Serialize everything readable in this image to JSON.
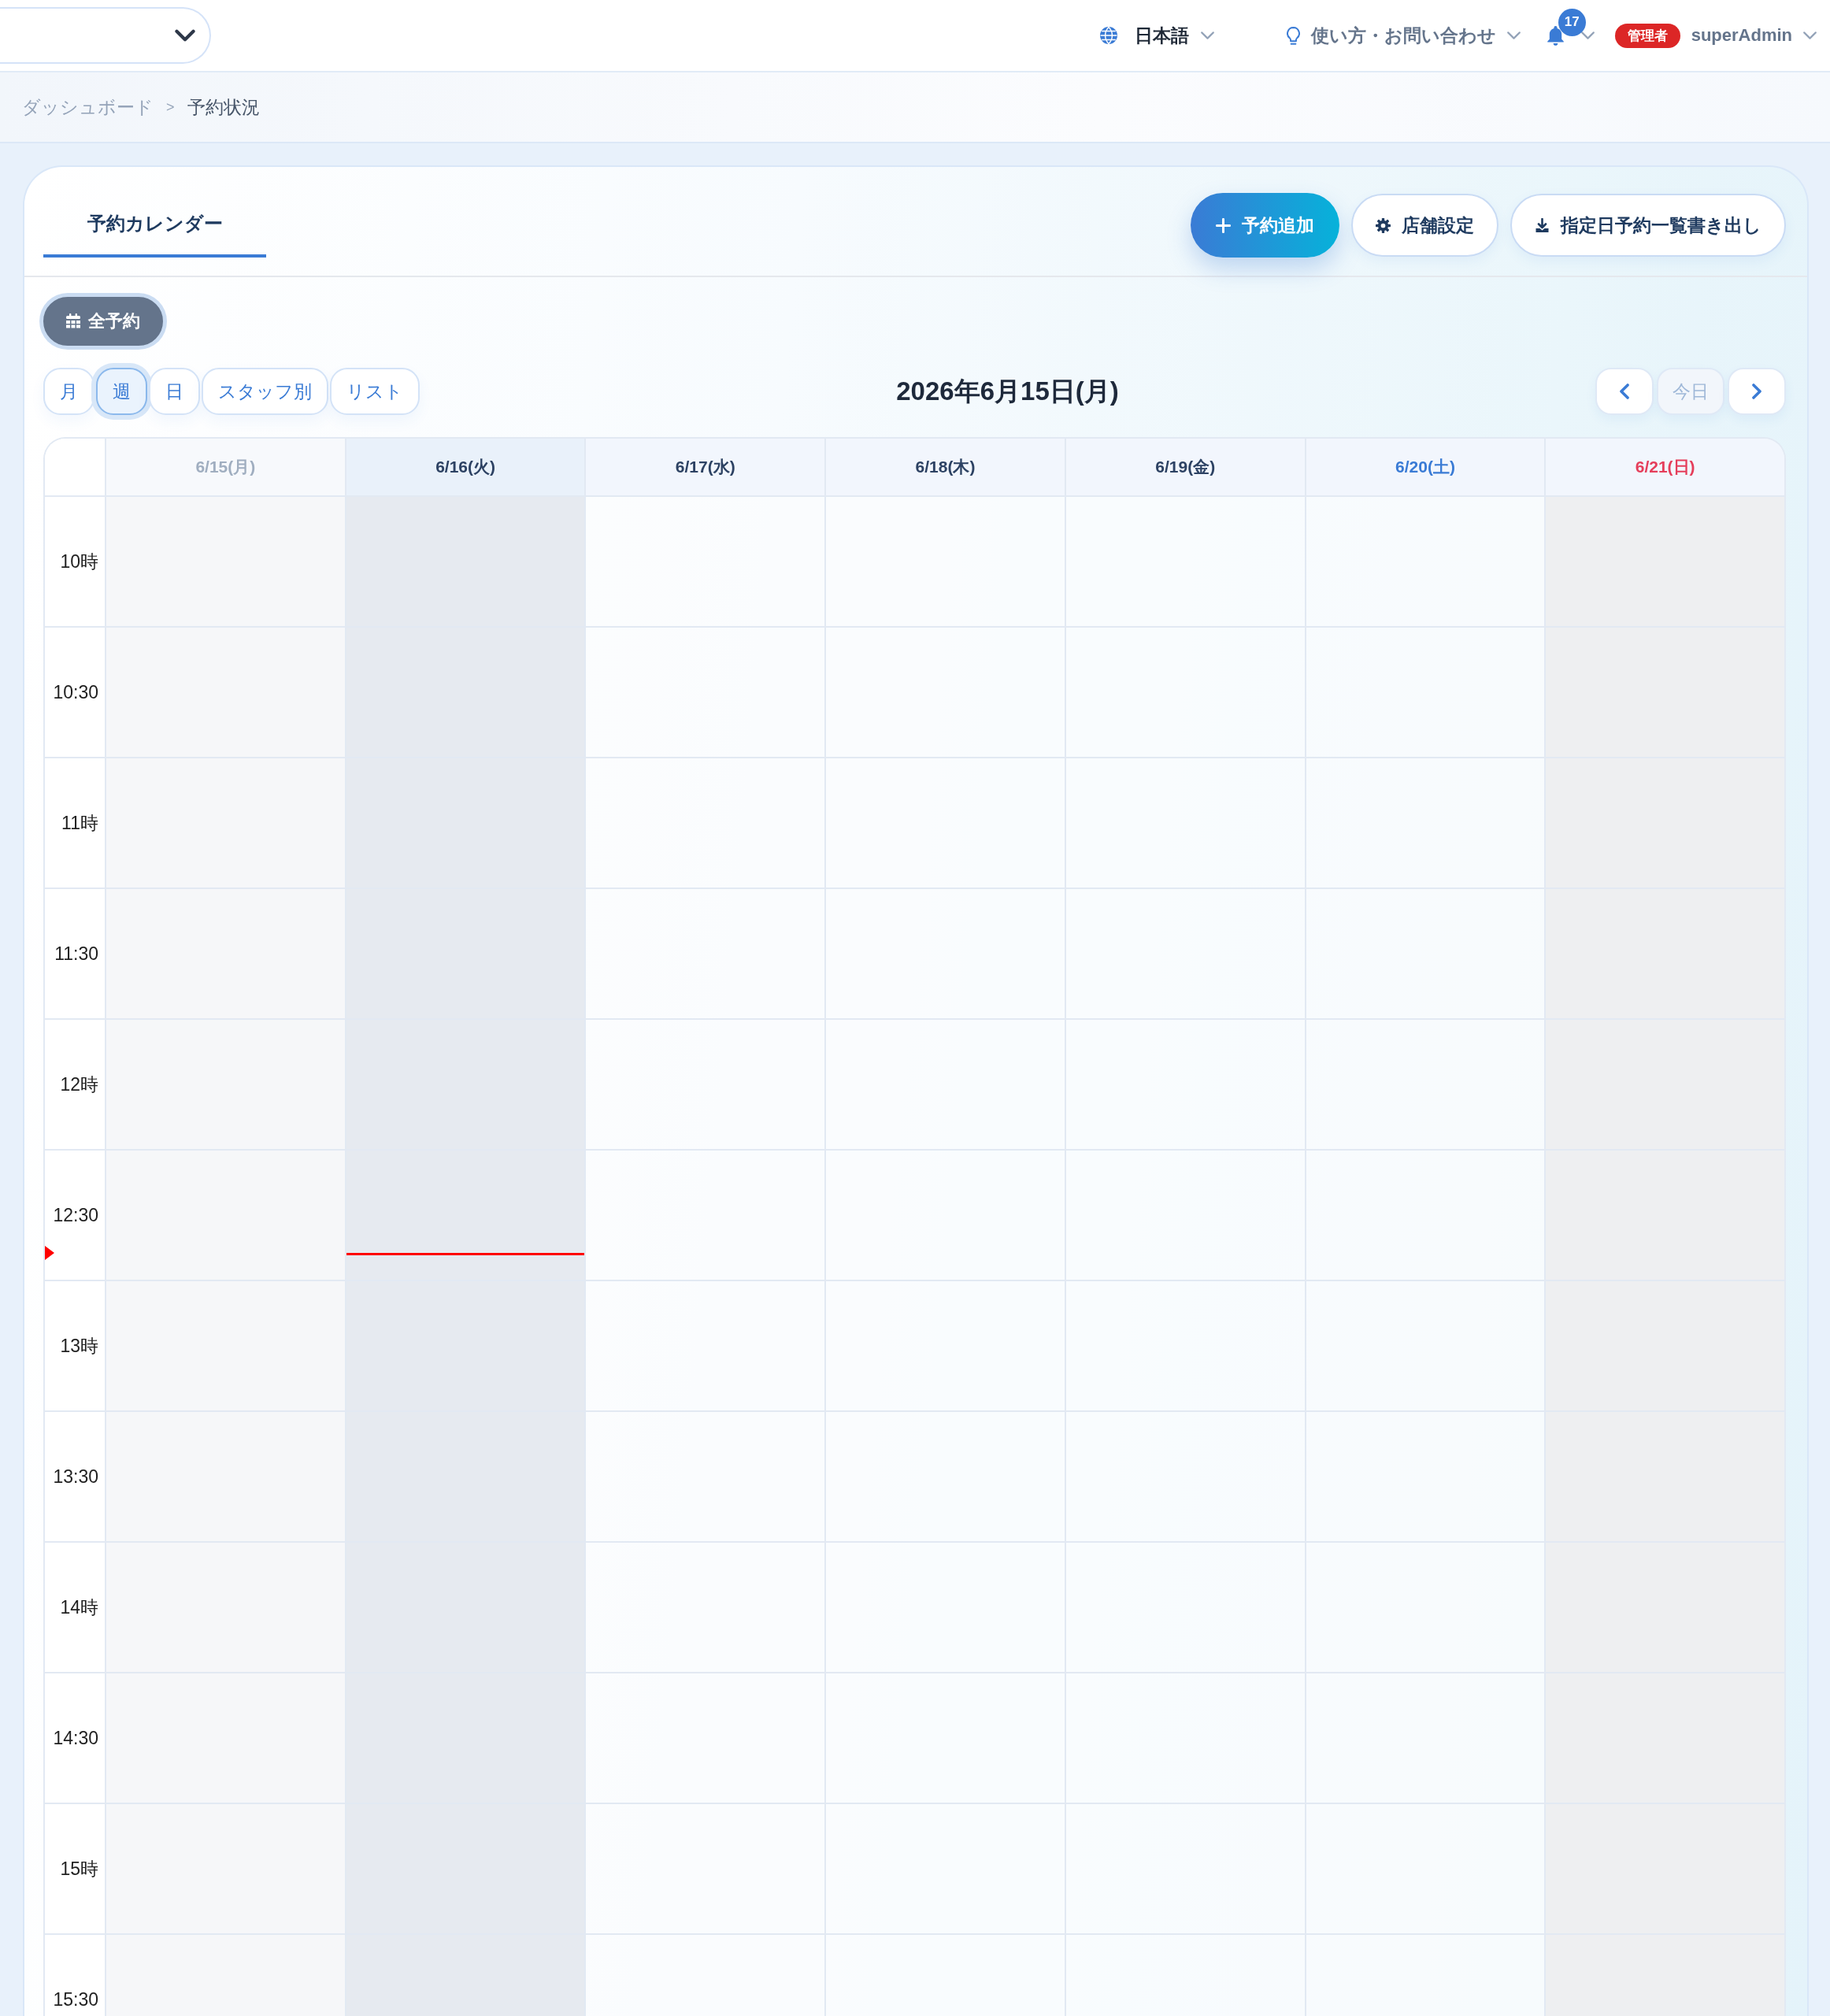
{
  "header": {
    "language": "日本語",
    "help": "使い方・お問い合わせ",
    "notification_count": "17",
    "role": "管理者",
    "user": "superAdmin"
  },
  "breadcrumb": {
    "separator": ">",
    "items": [
      {
        "label": "ダッシュボード",
        "current": false
      },
      {
        "label": "予約状況",
        "current": true
      }
    ]
  },
  "tabs": [
    {
      "label": "予約カレンダー",
      "selected": true
    }
  ],
  "actions": [
    {
      "label": "予約追加",
      "kind": "add"
    },
    {
      "label": "店舗設定",
      "kind": "settings"
    },
    {
      "label": "指定日予約一覧書き出し",
      "kind": "export"
    }
  ],
  "filter": {
    "label": "全予約",
    "selected": true
  },
  "views": [
    {
      "label": "月",
      "selected": false
    },
    {
      "label": "週",
      "selected": true
    },
    {
      "label": "日",
      "selected": false
    },
    {
      "label": "スタッフ別",
      "selected": false
    },
    {
      "label": "リスト",
      "selected": false
    }
  ],
  "title": "2026年6月15日(月)",
  "today_button": {
    "label": "今日",
    "disabled": true
  },
  "calendar": {
    "days": [
      {
        "label": "6/15(月)",
        "kind": "past"
      },
      {
        "label": "6/16(火)",
        "kind": "today"
      },
      {
        "label": "6/17(水)",
        "kind": "weekday"
      },
      {
        "label": "6/18(木)",
        "kind": "weekday"
      },
      {
        "label": "6/19(金)",
        "kind": "weekday"
      },
      {
        "label": "6/20(土)",
        "kind": "saturday"
      },
      {
        "label": "6/21(日)",
        "kind": "sunday"
      }
    ],
    "slots": [
      {
        "label": "10時",
        "now": false
      },
      {
        "label": "10:30",
        "now": false
      },
      {
        "label": "11時",
        "now": false
      },
      {
        "label": "11:30",
        "now": false
      },
      {
        "label": "12時",
        "now": false
      },
      {
        "label": "12:30",
        "now": true
      },
      {
        "label": "13時",
        "now": false
      },
      {
        "label": "13:30",
        "now": false
      },
      {
        "label": "14時",
        "now": false
      },
      {
        "label": "14:30",
        "now": false
      },
      {
        "label": "15時",
        "now": false
      },
      {
        "label": "15:30",
        "now": false
      }
    ]
  }
}
